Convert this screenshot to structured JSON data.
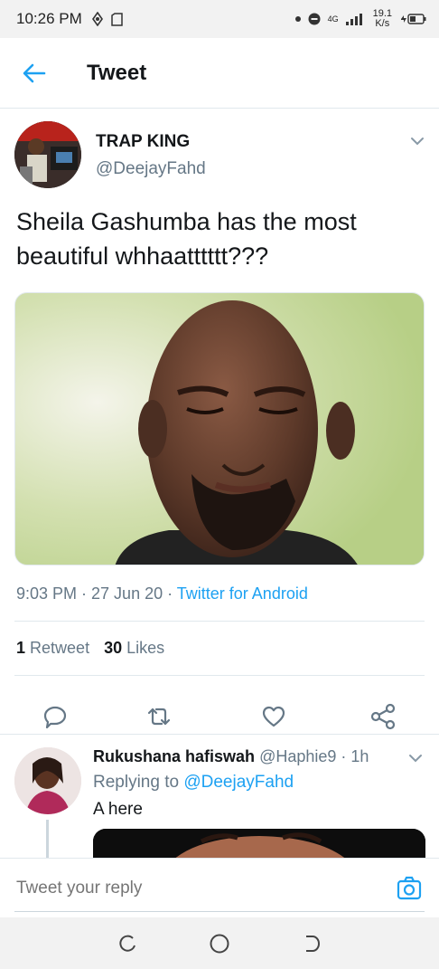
{
  "status_bar": {
    "time": "10:26 PM",
    "network_type": "4G",
    "data_rate_value": "19.1",
    "data_rate_unit": "K/s"
  },
  "app_bar": {
    "title": "Tweet"
  },
  "tweet": {
    "author_name": "TRAP KING",
    "author_handle": "@DeejayFahd",
    "text": "Sheila Gashumba has the most beautiful whhaatttttt???",
    "timestamp": "9:03 PM · 27 Jun 20 · ",
    "source": "Twitter for Android",
    "retweet_count": "1",
    "retweet_label": "Retweet",
    "likes_count": "30",
    "likes_label": "Likes"
  },
  "reply": {
    "author_name": "Rukushana hafiswah",
    "author_handle": "@Haphie9",
    "time": "· 1h",
    "replying_to_prefix": "Replying to ",
    "replying_to_handle": "@DeejayFahd",
    "text": "A here"
  },
  "compose": {
    "placeholder": "Tweet your reply"
  },
  "colors": {
    "accent": "#1da1f2",
    "secondary_text": "#657786",
    "divider": "#e1e8ed"
  },
  "icons": [
    "back-arrow-icon",
    "chevron-down-icon",
    "reply-icon",
    "retweet-icon",
    "like-icon",
    "share-icon",
    "camera-icon",
    "recents-icon",
    "home-icon",
    "back-icon"
  ]
}
